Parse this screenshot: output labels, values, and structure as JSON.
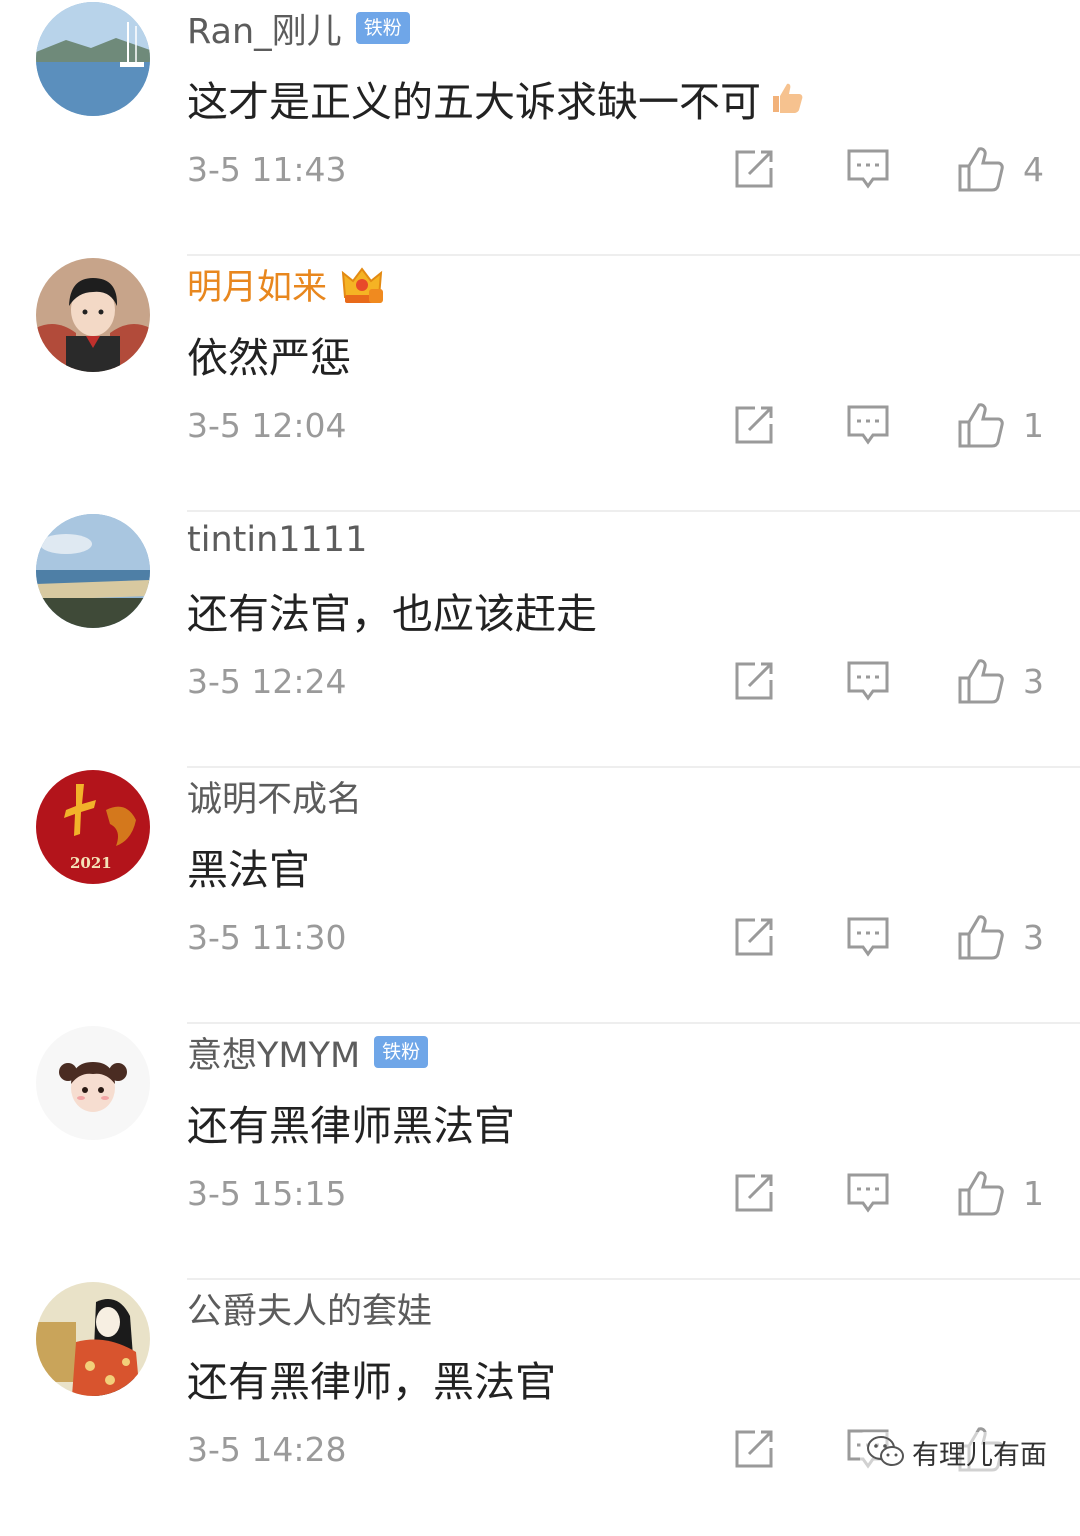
{
  "comments": [
    {
      "username": "Ran_刚儿",
      "badge": "铁粉",
      "text": "这才是正义的五大诉求缺一不可",
      "time": "3-5 11:43",
      "likes": "4"
    },
    {
      "username": "明月如来",
      "text": "依然严惩",
      "time": "3-5 12:04",
      "likes": "1"
    },
    {
      "username": "tintin1111",
      "text": "还有法官，也应该赶走",
      "time": "3-5 12:24",
      "likes": "3"
    },
    {
      "username": "诚明不成名",
      "text": "黑法官",
      "time": "3-5 11:30",
      "likes": "3"
    },
    {
      "username": "意想YMYM",
      "badge": "铁粉",
      "text": "还有黑律师黑法官",
      "time": "3-5 15:15",
      "likes": "1"
    },
    {
      "username": "公爵夫人的套娃",
      "text": "还有黑律师，黑法官",
      "time": "3-5 14:28",
      "likes": ""
    }
  ],
  "avatar_texts": {
    "c4_year": "2021"
  },
  "watermark": {
    "text": "有理儿有面"
  },
  "colors": {
    "vip_name": "#e8871e",
    "badge_bg": "#6fa6e8",
    "icon_gray": "#9a9a9a"
  }
}
